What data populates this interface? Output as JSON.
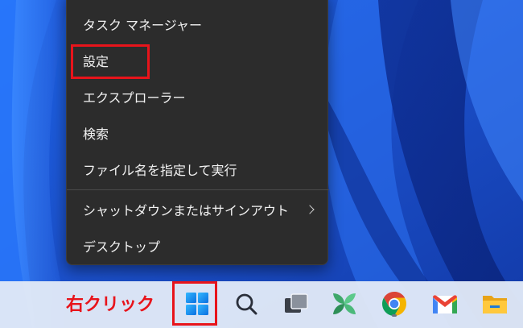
{
  "context_menu": {
    "items": [
      {
        "label": "タスク マネージャー"
      },
      {
        "label": "設定"
      },
      {
        "label": "エクスプローラー"
      },
      {
        "label": "検索"
      },
      {
        "label": "ファイル名を指定して実行"
      },
      {
        "label": "シャットダウンまたはサインアウト",
        "has_submenu": true
      },
      {
        "label": "デスクトップ"
      }
    ],
    "highlighted_item": "設定"
  },
  "annotation": {
    "text": "右クリック",
    "color": "#e8141b"
  },
  "taskbar": {
    "icons": [
      {
        "name": "start-windows-icon",
        "highlighted": true
      },
      {
        "name": "search-icon"
      },
      {
        "name": "task-view-icon"
      },
      {
        "name": "widgets-icon"
      },
      {
        "name": "chrome-icon"
      },
      {
        "name": "gmail-icon"
      },
      {
        "name": "file-explorer-icon"
      }
    ]
  },
  "colors": {
    "menu_bg": "#2c2c2c",
    "highlight": "#e8141b",
    "wallpaper": "#1f5fd8"
  }
}
